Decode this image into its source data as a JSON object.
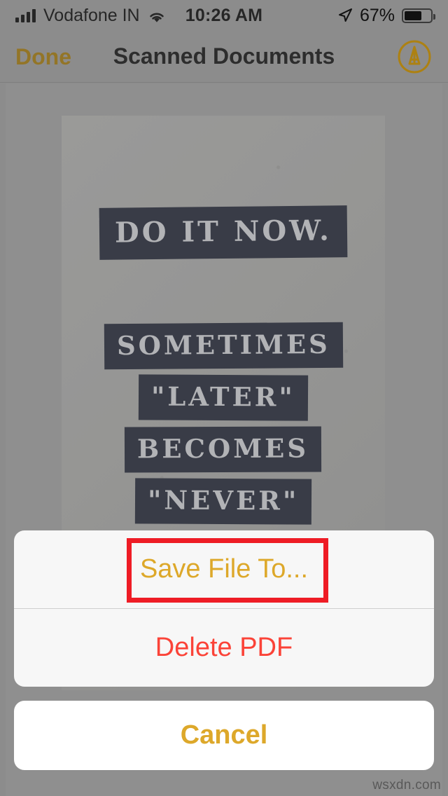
{
  "status_bar": {
    "signal_icon": "signal-bars-icon",
    "carrier": "Vodafone IN",
    "wifi_icon": "wifi-icon",
    "time": "10:26 AM",
    "location_icon": "location-arrow-icon",
    "battery_percent": "67%",
    "battery_icon": "battery-icon",
    "battery_level": 67
  },
  "nav_bar": {
    "done_label": "Done",
    "title": "Scanned Documents",
    "markup_icon": "markup-pen-icon"
  },
  "document": {
    "headline": "DO IT NOW.",
    "lines": [
      "SOMETIMES",
      "\"LATER\"",
      "BECOMES",
      "\"NEVER\""
    ]
  },
  "action_sheet": {
    "save_label": "Save File To...",
    "delete_label": "Delete PDF",
    "cancel_label": "Cancel"
  },
  "annotation": {
    "target": "save-file-to-button",
    "color": "#ee1c25"
  },
  "watermark": "wsxdn.com",
  "colors": {
    "tint_gold": "#dda82a",
    "nav_gold": "#ad8112",
    "destructive_red": "#fb4338",
    "annotation_red": "#ee1c25",
    "band_navy": "#2c3040",
    "background_gray": "#a3a3a3"
  }
}
